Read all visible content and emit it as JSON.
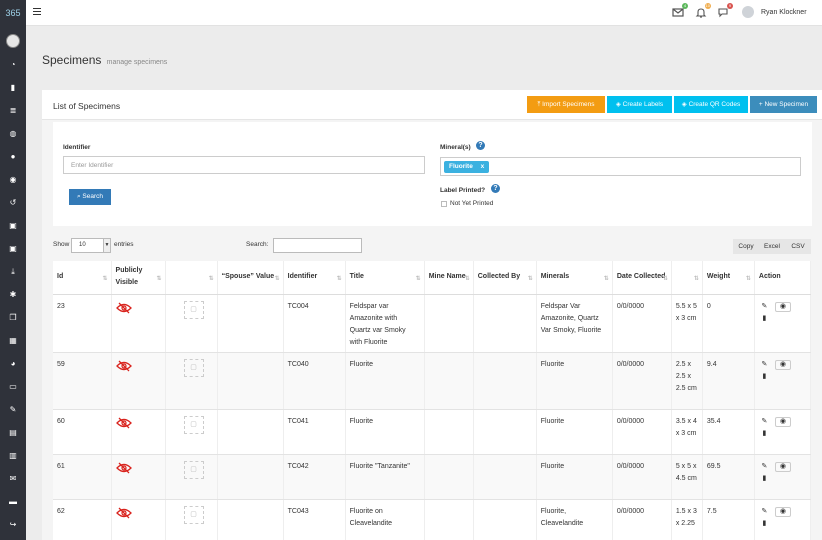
{
  "app": {
    "logo_text": "365",
    "user_name": "Ryan Klockner",
    "notifications": [
      {
        "icon": "envelope-icon",
        "count": "4",
        "color": "#5cb85c"
      },
      {
        "icon": "bell-icon",
        "count": "10",
        "color": "#f0ad4e"
      },
      {
        "icon": "flag-icon",
        "count": "9",
        "color": "#d9534f"
      }
    ]
  },
  "sidebar": {
    "icons": [
      "dashboard-icon",
      "building-icon",
      "list-icon",
      "globe-icon",
      "user-icon",
      "users-icon",
      "history-icon",
      "lock-icon",
      "lock-icon",
      "download-icon",
      "settings-icon",
      "copy-icon",
      "grid-icon",
      "pie-chart-icon",
      "laptop-icon",
      "edit-icon",
      "table-icon",
      "calendar-icon",
      "mail-icon",
      "folder-icon",
      "share-icon"
    ]
  },
  "page": {
    "title": "Specimens",
    "subtitle": "manage specimens"
  },
  "panel": {
    "title": "List of Specimens",
    "buttons": {
      "import": "Import Specimens",
      "labels": "Create Labels",
      "qr": "Create QR Codes",
      "new": "New Specimen"
    },
    "colors": {
      "import": "#f39c12",
      "labels": "#00c0ef",
      "qr": "#00c0ef",
      "new": "#3c8dbc"
    }
  },
  "filters": {
    "identifier_label": "Identifier",
    "identifier_placeholder": "Enter Identifier",
    "search_button": "Search",
    "minerals_label": "Mineral(s)",
    "mineral_tag": "Fluorite",
    "mineral_tag_remove": "x",
    "label_printed_label": "Label Printed?",
    "not_yet_printed": "Not Yet Printed"
  },
  "table_controls": {
    "show": "Show",
    "length": "10",
    "entries": "entries",
    "search": "Search:",
    "copy": "Copy",
    "excel": "Excel",
    "csv": "CSV"
  },
  "table": {
    "headers": [
      "Id",
      "Publicly Visible",
      "",
      "“Spouse” Value",
      "Identifier",
      "Title",
      "Mine Name",
      "Collected By",
      "Minerals",
      "Date Collected",
      "",
      "Weight",
      "Action"
    ],
    "rows": [
      {
        "id": "23",
        "identifier": "TC004",
        "title": "Feldspar var Amazonite with Quartz var Smoky with Fluorite",
        "mine": "",
        "collected_by": "",
        "minerals": "Feldspar Var Amazonite, Quartz Var Smoky, Fluorite",
        "date": "0/0/0000",
        "size": "5.5 x 5 x 3 cm",
        "weight": "0"
      },
      {
        "id": "59",
        "identifier": "TC040",
        "title": "Fluorite",
        "mine": "",
        "collected_by": "",
        "minerals": "Fluorite",
        "date": "0/0/0000",
        "size": "2.5 x 2.5 x 2.5 cm",
        "weight": "9.4"
      },
      {
        "id": "60",
        "identifier": "TC041",
        "title": "Fluorite",
        "mine": "",
        "collected_by": "",
        "minerals": "Fluorite",
        "date": "0/0/0000",
        "size": "3.5 x 4 x 3 cm",
        "weight": "35.4"
      },
      {
        "id": "61",
        "identifier": "TC042",
        "title": "Fluorite \"Tanzanite\"",
        "mine": "",
        "collected_by": "",
        "minerals": "Fluorite",
        "date": "0/0/0000",
        "size": "5 x 5 x 4.5 cm",
        "weight": "69.5"
      },
      {
        "id": "62",
        "identifier": "TC043",
        "title": "Fluorite on Cleavelandite",
        "mine": "",
        "collected_by": "",
        "minerals": "Fluorite, Cleavelandite",
        "date": "0/0/0000",
        "size": "1.5 x 3 x 2.25",
        "weight": "7.5"
      }
    ]
  }
}
